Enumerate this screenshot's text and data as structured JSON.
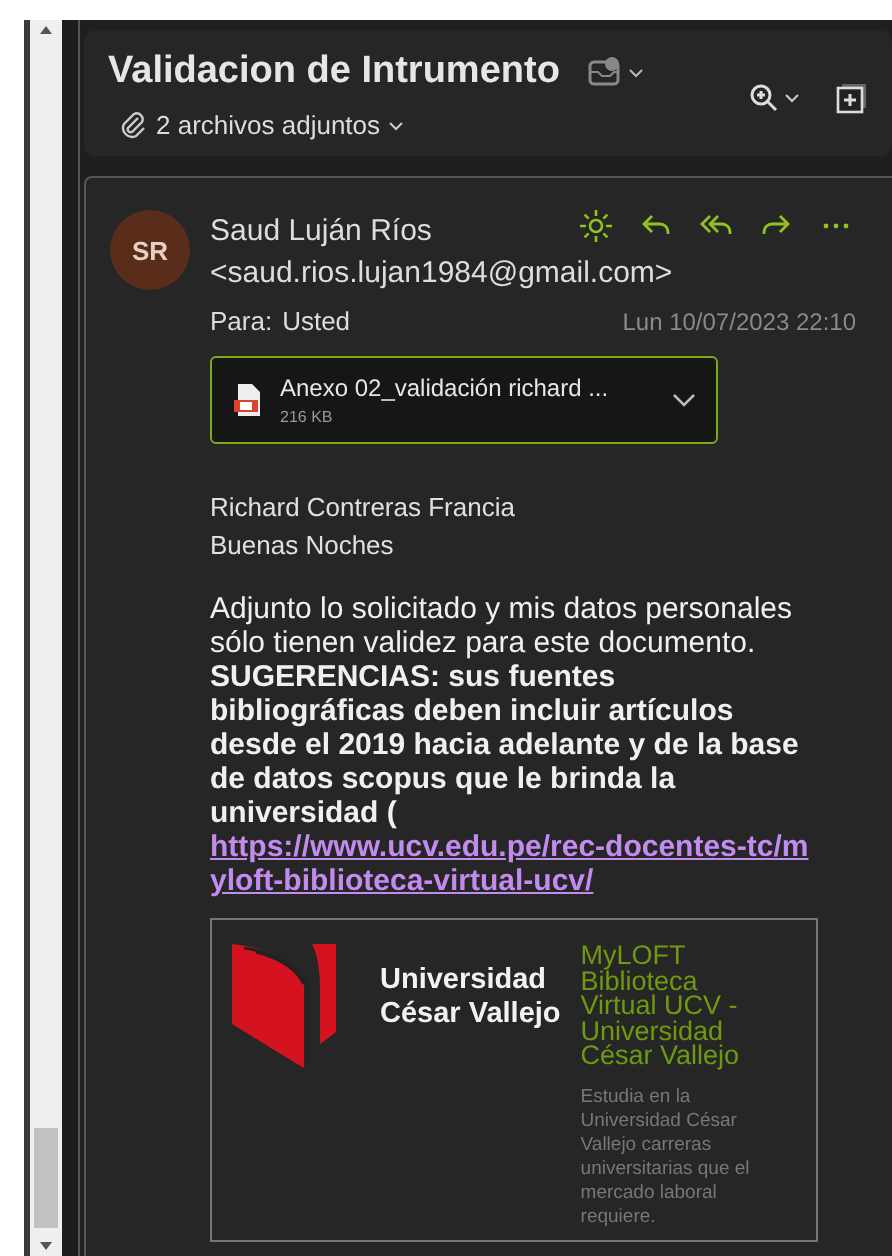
{
  "header": {
    "subject": "Validacion de Intrumento",
    "attachments_label": "2 archivos adjuntos"
  },
  "message": {
    "avatar_initials": "SR",
    "sender_name": "Saud Luján Ríos",
    "sender_email": "<saud.rios.lujan1984@gmail.com>",
    "to_label": "Para:",
    "to_value": "Usted",
    "date": "Lun 10/07/2023 22:10",
    "attachment": {
      "name": "Anexo 02_validación richard ...",
      "size": "216 KB"
    },
    "body_lines": [
      "Richard Contreras Francia",
      "Buenas Noches"
    ],
    "paragraph": "Adjunto lo solicitado y mis datos personales sólo tienen validez para este documento. **SUGERENCIAS: sus fuentes bibliográficas deben incluir artículos desde el 2019 hacia adelante y de la base de datos scopus que le brinda la universidad (**",
    "link": "https://www.ucv.edu.pe/rec-docentes-tc/myloft-biblioteca-virtual-ucv/",
    "preview": {
      "logo_line_1": "Universidad",
      "logo_line_2": "César Vallejo",
      "title": "MyLOFT Biblioteca Virtual UCV - Universidad César Vallejo",
      "description": "Estudia en la Universidad César Vallejo carreras universitarias que el mercado laboral requiere."
    }
  }
}
